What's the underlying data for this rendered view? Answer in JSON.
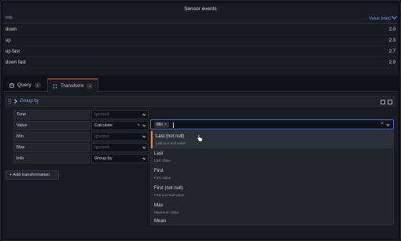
{
  "panel": {
    "title": "Sensor events",
    "columns": {
      "info": "Info",
      "value": "Value (min)"
    },
    "rows": [
      {
        "info": "down",
        "value": "2.0"
      },
      {
        "info": "up",
        "value": "2.3"
      },
      {
        "info": "up fast",
        "value": "2.7"
      },
      {
        "info": "down fast",
        "value": "2.9"
      }
    ]
  },
  "tabs": [
    {
      "label": "Query",
      "count": "1",
      "icon": "database-icon"
    },
    {
      "label": "Transform",
      "count": "1",
      "icon": "transform-icon"
    }
  ],
  "transformation": {
    "title": "Group by",
    "fields": [
      {
        "name": "Time",
        "option": "Ignored",
        "ignored": true
      },
      {
        "name": "Value",
        "option": "Calculate",
        "ignored": false
      },
      {
        "name": "Min",
        "option": "Ignored",
        "ignored": true
      },
      {
        "name": "Max",
        "option": "Ignored",
        "ignored": true
      },
      {
        "name": "Info",
        "option": "Group by",
        "ignored": false
      }
    ],
    "calculation": {
      "selected_chip": "Min"
    }
  },
  "dropdown_options": [
    {
      "label": "Last (not null)",
      "description": "Last non-null value"
    },
    {
      "label": "Last",
      "description": "Last Value"
    },
    {
      "label": "First",
      "description": "First Value"
    },
    {
      "label": "First (not null)",
      "description": "First non-null value"
    },
    {
      "label": "Max",
      "description": "Maximum Value"
    },
    {
      "label": "Mean",
      "description": ""
    }
  ],
  "add_transformation_label": "+ Add transformation",
  "colors": {
    "accent": "#6e9fff",
    "focus_border": "#3d71d9",
    "tab_active": "#f05a28"
  }
}
